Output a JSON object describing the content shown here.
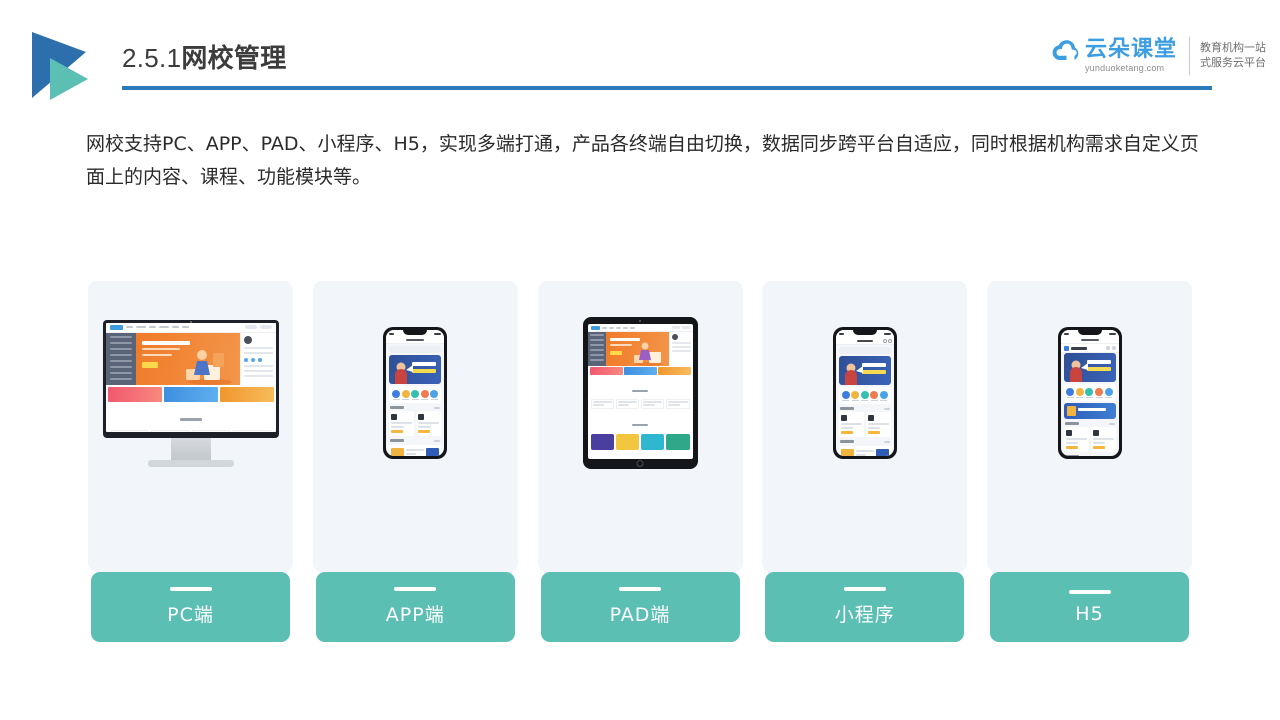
{
  "header": {
    "section_number": "2.5.1",
    "section_title": "网校管理",
    "accent_color": "#2d7ab8",
    "logo_triangle_dark": "#2d6ead",
    "logo_triangle_teal": "#5cbfb4"
  },
  "brand": {
    "name_cn": "云朵课堂",
    "url": "yunduoketang.com",
    "tagline_line1": "教育机构一站",
    "tagline_line2": "式服务云平台",
    "cloud_color": "#3c9ee0"
  },
  "body": {
    "paragraph": "网校支持PC、APP、PAD、小程序、H5，实现多端打通，产品各终端自由切换，数据同步跨平台自适应，同时根据机构需求自定义页面上的内容、课程、功能模块等。"
  },
  "devices": {
    "label_color": "#5cbfb4",
    "card_background": "#f2f5fa",
    "items": [
      {
        "label": "PC端",
        "mock": "desktop"
      },
      {
        "label": "APP端",
        "mock": "phone"
      },
      {
        "label": "PAD端",
        "mock": "tablet"
      },
      {
        "label": "小程序",
        "mock": "miniprogram"
      },
      {
        "label": "H5",
        "mock": "h5"
      }
    ]
  }
}
